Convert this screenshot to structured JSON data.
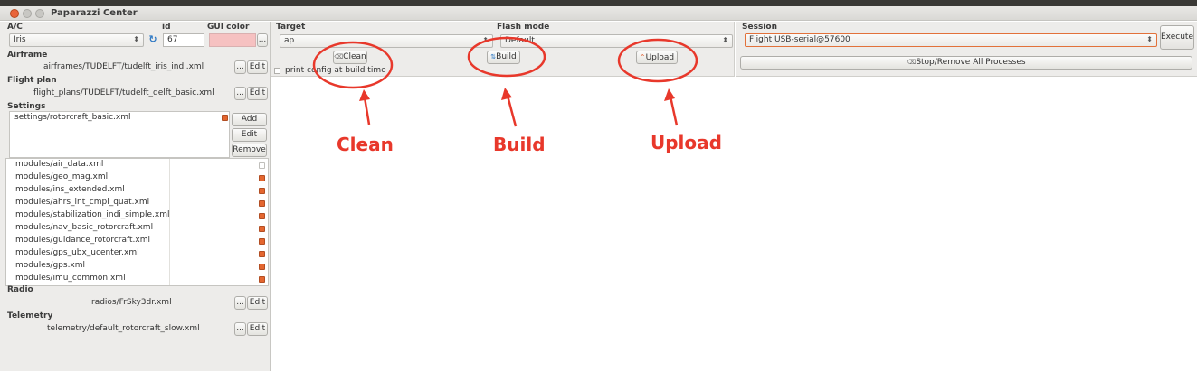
{
  "window": {
    "title": "Paparazzi Center"
  },
  "ac": {
    "label": "A/C",
    "value": "Iris",
    "id_label": "id",
    "id_value": "67",
    "gui_color_label": "GUI color",
    "gui_color": "#f6c1c1",
    "browse_label": "..."
  },
  "airframe": {
    "label": "Airframe",
    "path": "airframes/TUDELFT/tudelft_iris_indi.xml",
    "browse_label": "...",
    "edit_label": "Edit"
  },
  "flight_plan": {
    "label": "Flight plan",
    "path": "flight_plans/TUDELFT/tudelft_delft_basic.xml",
    "browse_label": "...",
    "edit_label": "Edit"
  },
  "settings": {
    "label": "Settings",
    "items": [
      {
        "path": "settings/rotorcraft_basic.xml",
        "checked": true
      }
    ],
    "add_label": "Add",
    "edit_label": "Edit",
    "remove_label": "Remove"
  },
  "modules": [
    {
      "path": "modules/air_data.xml",
      "checked": false
    },
    {
      "path": "modules/geo_mag.xml",
      "checked": true
    },
    {
      "path": "modules/ins_extended.xml",
      "checked": true
    },
    {
      "path": "modules/ahrs_int_cmpl_quat.xml",
      "checked": true
    },
    {
      "path": "modules/stabilization_indi_simple.xml",
      "checked": true
    },
    {
      "path": "modules/nav_basic_rotorcraft.xml",
      "checked": true
    },
    {
      "path": "modules/guidance_rotorcraft.xml",
      "checked": true
    },
    {
      "path": "modules/gps_ubx_ucenter.xml",
      "checked": true
    },
    {
      "path": "modules/gps.xml",
      "checked": true
    },
    {
      "path": "modules/imu_common.xml",
      "checked": true
    }
  ],
  "radio": {
    "label": "Radio",
    "path": "radios/FrSky3dr.xml",
    "browse_label": "...",
    "edit_label": "Edit"
  },
  "telemetry": {
    "label": "Telemetry",
    "path": "telemetry/default_rotorcraft_slow.xml",
    "browse_label": "...",
    "edit_label": "Edit"
  },
  "build": {
    "target_label": "Target",
    "target_value": "ap",
    "flash_mode_label": "Flash mode",
    "flash_mode_value": "Default",
    "clean_label": "Clean",
    "build_label": "Build",
    "upload_label": "Upload",
    "print_config_label": "print config at build time"
  },
  "session": {
    "label": "Session",
    "value": "Flight USB-serial@57600",
    "execute_label": "Execute",
    "stop_label": "Stop/Remove All Processes"
  },
  "annotations": {
    "clean": "Clean",
    "build": "Build",
    "upload": "Upload",
    "color": "#e8382b"
  }
}
